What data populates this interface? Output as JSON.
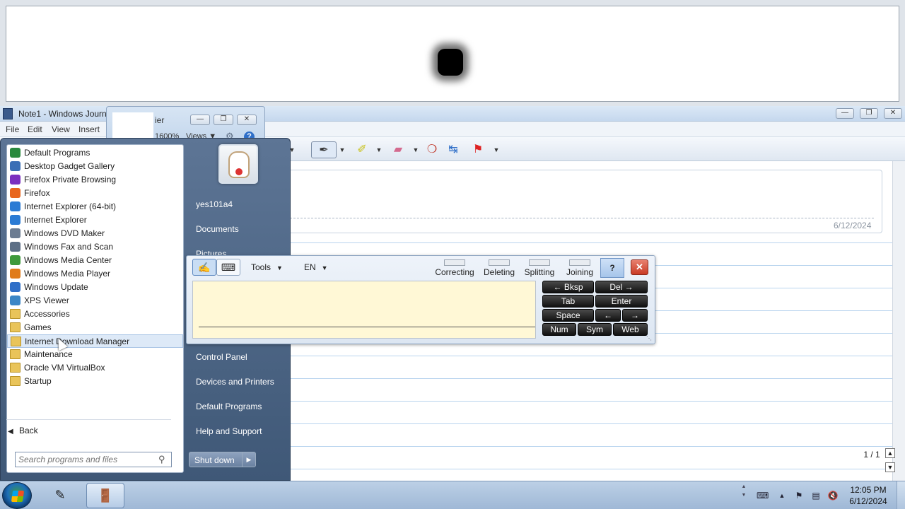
{
  "journal": {
    "title": "Note1 - Windows Journ",
    "menu": [
      "File",
      "Edit",
      "View",
      "Insert"
    ],
    "date": "6/12/2024",
    "page_indicator": "1 / 1"
  },
  "magnifier_window": {
    "title_fragment": "ier",
    "zoom": "1600%",
    "views": "Views"
  },
  "start_menu": {
    "programs": [
      {
        "label": "Default Programs",
        "icon": "default-programs-icon",
        "color": "#2a8a3e"
      },
      {
        "label": "Desktop Gadget Gallery",
        "icon": "gadget-icon",
        "color": "#3b6fb6"
      },
      {
        "label": "Firefox Private Browsing",
        "icon": "firefox-private-icon",
        "color": "#7b2fbf"
      },
      {
        "label": "Firefox",
        "icon": "firefox-icon",
        "color": "#e8661f"
      },
      {
        "label": "Internet Explorer (64-bit)",
        "icon": "ie-icon",
        "color": "#2b7bd4"
      },
      {
        "label": "Internet Explorer",
        "icon": "ie-icon",
        "color": "#2b7bd4"
      },
      {
        "label": "Windows DVD Maker",
        "icon": "dvd-maker-icon",
        "color": "#6b7c92"
      },
      {
        "label": "Windows Fax and Scan",
        "icon": "fax-scan-icon",
        "color": "#5c6f86"
      },
      {
        "label": "Windows Media Center",
        "icon": "media-center-icon",
        "color": "#3f9a3c"
      },
      {
        "label": "Windows Media Player",
        "icon": "media-player-icon",
        "color": "#e07b1a"
      },
      {
        "label": "Windows Update",
        "icon": "windows-update-icon",
        "color": "#2f6fc8"
      },
      {
        "label": "XPS Viewer",
        "icon": "xps-viewer-icon",
        "color": "#3b86c6"
      },
      {
        "label": "Accessories",
        "icon": "folder-icon",
        "color": "#e9c45a"
      },
      {
        "label": "Games",
        "icon": "folder-icon",
        "color": "#e9c45a"
      },
      {
        "label": "Internet Download Manager",
        "icon": "folder-icon",
        "color": "#e9c45a"
      },
      {
        "label": "Maintenance",
        "icon": "folder-icon",
        "color": "#e9c45a"
      },
      {
        "label": "Oracle VM VirtualBox",
        "icon": "folder-icon",
        "color": "#e9c45a"
      },
      {
        "label": "Startup",
        "icon": "folder-icon",
        "color": "#e9c45a"
      }
    ],
    "highlighted_index": 14,
    "back_label": "Back",
    "search_placeholder": "Search programs and files",
    "user_name": "yes101a4",
    "right_items": [
      "Documents",
      "Pictures",
      "Control Panel",
      "Devices and Printers",
      "Default Programs",
      "Help and Support"
    ],
    "shutdown_label": "Shut down"
  },
  "input_panel": {
    "tools_label": "Tools",
    "language_label": "EN",
    "gestures": [
      "Correcting",
      "Deleting",
      "Splitting",
      "Joining"
    ],
    "keys": {
      "bksp": "← Bksp",
      "del": "Del →",
      "tab": "Tab",
      "enter": "Enter",
      "space": "Space",
      "left": "←",
      "right": "→",
      "num": "Num",
      "sym": "Sym",
      "web": "Web"
    }
  },
  "taskbar": {
    "time": "12:05 PM",
    "date": "6/12/2024"
  }
}
